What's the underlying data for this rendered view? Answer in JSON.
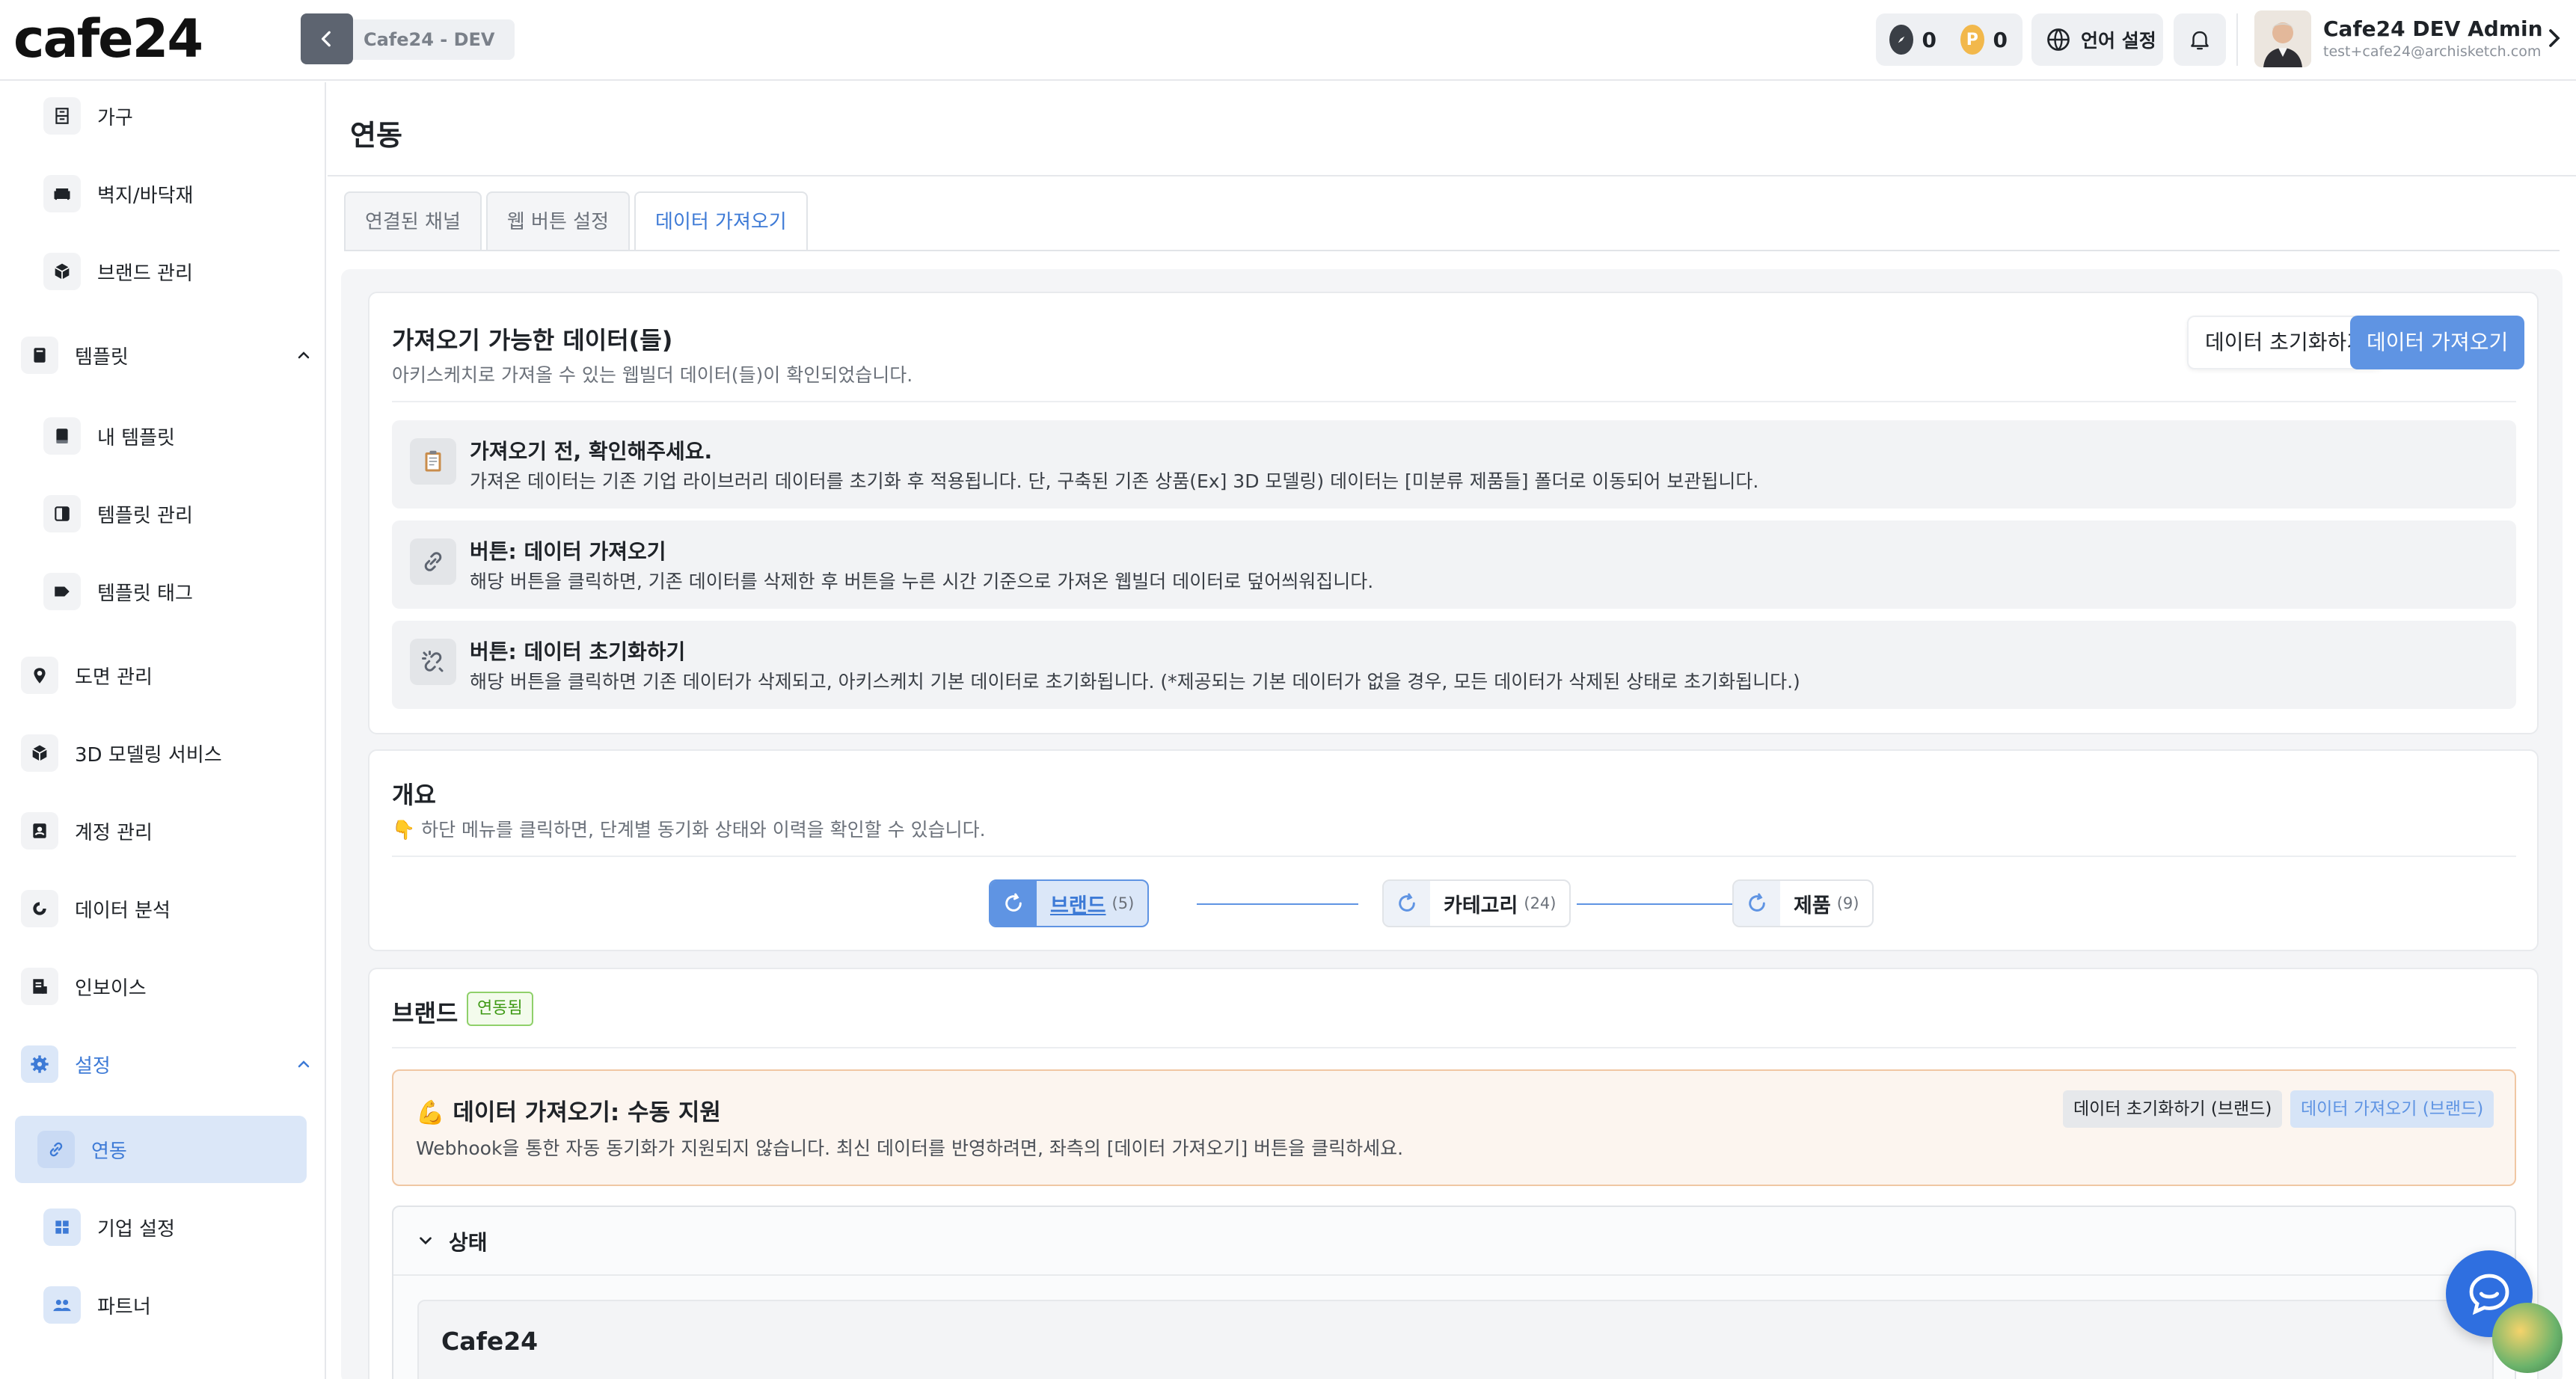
{
  "header": {
    "logo": "cafe24",
    "env_label": "Cafe24 - DEV",
    "points": [
      {
        "icon": "compass-icon",
        "value": "0",
        "color": "#3a3f46"
      },
      {
        "icon": "p-coin-icon",
        "letter": "P",
        "value": "0",
        "color": "#f2b84b"
      }
    ],
    "language_label": "언어 설정",
    "user": {
      "name": "Cafe24 DEV Admin",
      "email": "test+cafe24@archisketch.com"
    }
  },
  "sidebar": {
    "items": [
      {
        "label": "가구",
        "icon": "furniture-icon",
        "level": "sub"
      },
      {
        "label": "벽지/바닥재",
        "icon": "sofa-icon",
        "level": "sub"
      },
      {
        "label": "브랜드 관리",
        "icon": "cube-icon",
        "level": "sub"
      },
      {
        "label": "템플릿",
        "icon": "template-icon",
        "level": "top",
        "expanded": true
      },
      {
        "label": "내 템플릿",
        "icon": "book-icon",
        "level": "sub"
      },
      {
        "label": "템플릿 관리",
        "icon": "layout-icon",
        "level": "sub"
      },
      {
        "label": "템플릿 태그",
        "icon": "tag-icon",
        "level": "sub"
      },
      {
        "label": "도면 관리",
        "icon": "pin-icon",
        "level": "top"
      },
      {
        "label": "3D 모델링 서비스",
        "icon": "cube-icon",
        "level": "top"
      },
      {
        "label": "계정 관리",
        "icon": "account-icon",
        "level": "top"
      },
      {
        "label": "데이터 분석",
        "icon": "chart-ring-icon",
        "level": "top"
      },
      {
        "label": "인보이스",
        "icon": "invoice-icon",
        "level": "top"
      },
      {
        "label": "설정",
        "icon": "gear-icon",
        "level": "top",
        "expanded": true,
        "highlight": true
      },
      {
        "label": "연동",
        "icon": "link-icon",
        "level": "sub",
        "active": true
      },
      {
        "label": "기업 설정",
        "icon": "grid-icon",
        "level": "sub"
      },
      {
        "label": "파트너",
        "icon": "people-icon",
        "level": "sub"
      }
    ]
  },
  "main": {
    "title": "연동",
    "tabs": [
      {
        "label": "연결된 채널",
        "active": false
      },
      {
        "label": "웹 버튼 설정",
        "active": false
      },
      {
        "label": "데이터 가져오기",
        "active": true
      }
    ],
    "import_card": {
      "title": "가져오기 가능한 데이터(들)",
      "subtitle": "아키스케치로 가져올 수 있는 웹빌더 데이터(들)이 확인되었습니다.",
      "reset_button": "데이터 초기화하기",
      "import_button": "데이터 가져오기",
      "notes": [
        {
          "icon": "clipboard-icon",
          "title": "가져오기 전, 확인해주세요.",
          "text": "가져온 데이터는 기존 기업 라이브러리 데이터를 초기화 후 적용됩니다. 단, 구축된 기존 상품(Ex] 3D 모델링) 데이터는 [미분류 제품들] 폴더로 이동되어 보관됩니다."
        },
        {
          "icon": "link-icon",
          "title": "버튼: 데이터 가져오기",
          "text": "해당 버튼을 클릭하면, 기존 데이터를 삭제한 후 버튼을 누른 시간 기준으로 가져온 웹빌더 데이터로 덮어씌워집니다."
        },
        {
          "icon": "unlink-icon",
          "title": "버튼: 데이터 초기화하기",
          "text": "해당 버튼을 클릭하면 기존 데이터가 삭제되고, 아키스케치 기본 데이터로 초기화됩니다. (*제공되는 기본 데이터가 없을 경우, 모든 데이터가 삭제된 상태로 초기화됩니다.)"
        }
      ]
    },
    "overview": {
      "title": "개요",
      "hint_emoji": "👇",
      "hint": "하단 메뉴를 클릭하면, 단계별 동기화 상태와 이력을 확인할 수 있습니다.",
      "steps": [
        {
          "label": "브랜드",
          "count": "(5)",
          "active": true
        },
        {
          "label": "카테고리",
          "count": "(24)",
          "active": false
        },
        {
          "label": "제품",
          "count": "(9)",
          "active": false
        }
      ]
    },
    "brand_section": {
      "title": "브랜드",
      "badge": "연동됨",
      "warning": {
        "emoji": "💪",
        "title": "데이터 가져오기: 수동 지원",
        "text": "Webhook을 통한 자동 동기화가 지원되지 않습니다. 최신 데이터를 반영하려면, 좌측의 [데이터 가져오기] 버튼을 클릭하세요.",
        "reset_button": "데이터 초기화하기 (브랜드)",
        "import_button": "데이터 가져오기 (브랜드)"
      },
      "status_label": "상태",
      "store_name": "Cafe24"
    }
  },
  "colors": {
    "accent": "#3d7ad6",
    "primary_button": "#5f94e3",
    "success": "#3f9a16",
    "warning_border": "#f0c7a3"
  }
}
